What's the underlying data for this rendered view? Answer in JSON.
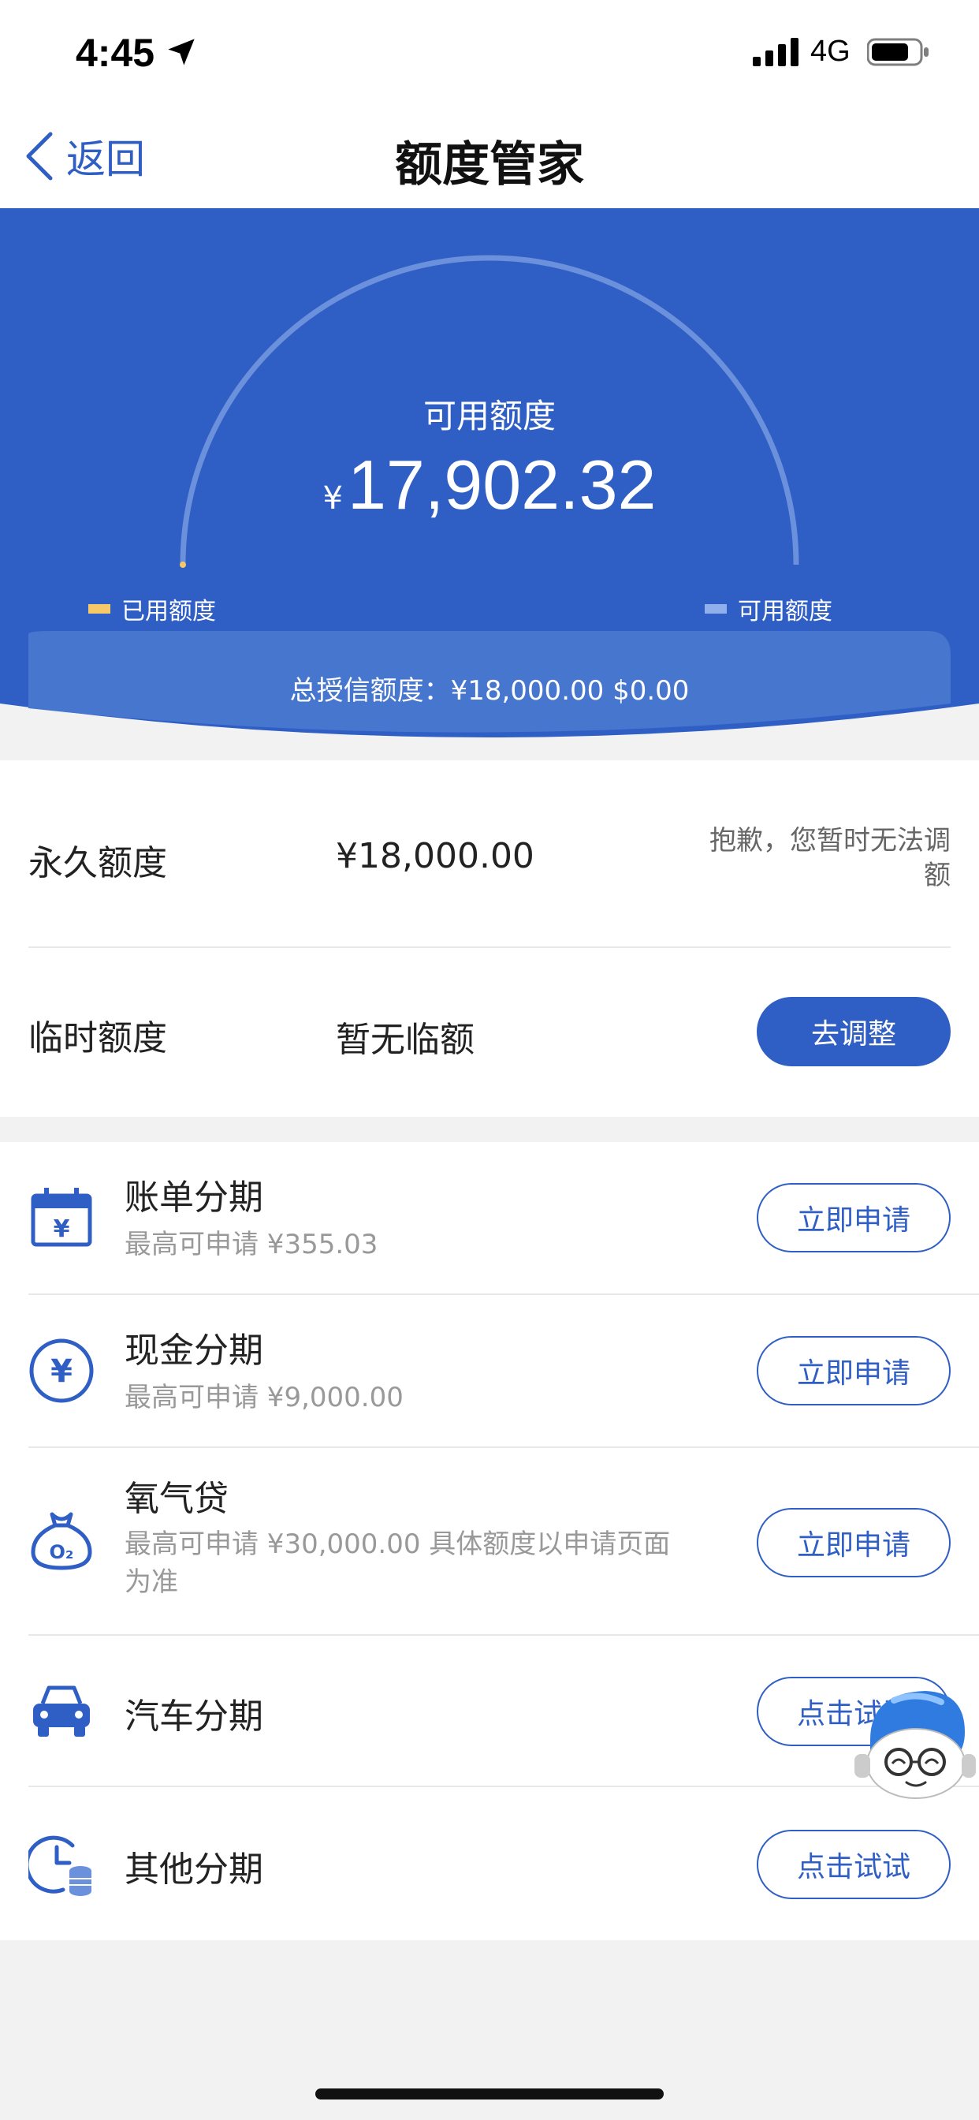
{
  "status_bar": {
    "time": "4:45",
    "network": "4G"
  },
  "nav": {
    "back_label": "返回",
    "title": "额度管家"
  },
  "summary": {
    "available_label": "可用额度",
    "currency": "¥",
    "available_amount": "17,902.32",
    "legend_used": "已用额度",
    "legend_available": "可用额度",
    "total_line": "总授信额度：¥18,000.00  $0.00",
    "colors": {
      "hero_blue": "#2f5fc4",
      "used_marker": "#f5c96a",
      "available_marker": "#8fb0ec"
    }
  },
  "limits": [
    {
      "label": "永久额度",
      "value": "¥18,000.00",
      "note": "抱歉，您暂时无法调额"
    },
    {
      "label": "临时额度",
      "value": "暂无临额",
      "button": "去调整"
    }
  ],
  "installments": [
    {
      "icon": "calendar-yen-icon",
      "name": "账单分期",
      "desc": "最高可申请  ¥355.03",
      "button": "立即申请"
    },
    {
      "icon": "yen-coin-icon",
      "name": "现金分期",
      "desc": "最高可申请  ¥9,000.00",
      "button": "立即申请"
    },
    {
      "icon": "o2-money-bag-icon",
      "name": "氧气贷",
      "desc": "最高可申请  ¥30,000.00  具体额度以申请页面为准",
      "button": "立即申请"
    },
    {
      "icon": "car-icon",
      "name": "汽车分期",
      "desc": "",
      "button": "点击试试"
    },
    {
      "icon": "clock-coins-icon",
      "name": "其他分期",
      "desc": "",
      "button": "点击试试"
    }
  ]
}
